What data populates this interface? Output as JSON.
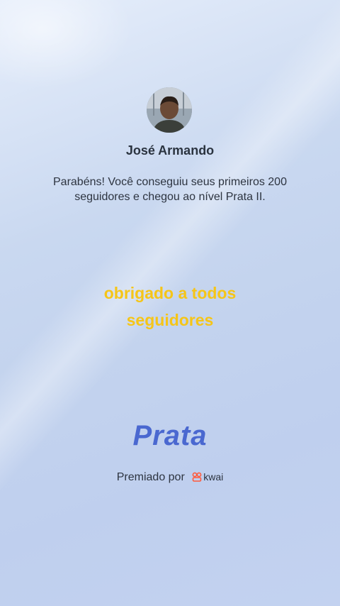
{
  "user": {
    "name": "José Armando"
  },
  "message": {
    "line1": "Parabéns! Você conseguiu seus primeiros 200",
    "line2": "seguidores e chegou ao nível Prata II."
  },
  "caption": {
    "line1": "obrigado a todos",
    "line2": "seguidores"
  },
  "level": {
    "label": "Prata"
  },
  "award": {
    "prefix": "Premiado por",
    "brand": "kwai",
    "brand_icon": "kwai-logo-icon",
    "brand_color": "#ff5a3c"
  },
  "colors": {
    "caption": "#f5c518",
    "level": "#4a68d0"
  }
}
